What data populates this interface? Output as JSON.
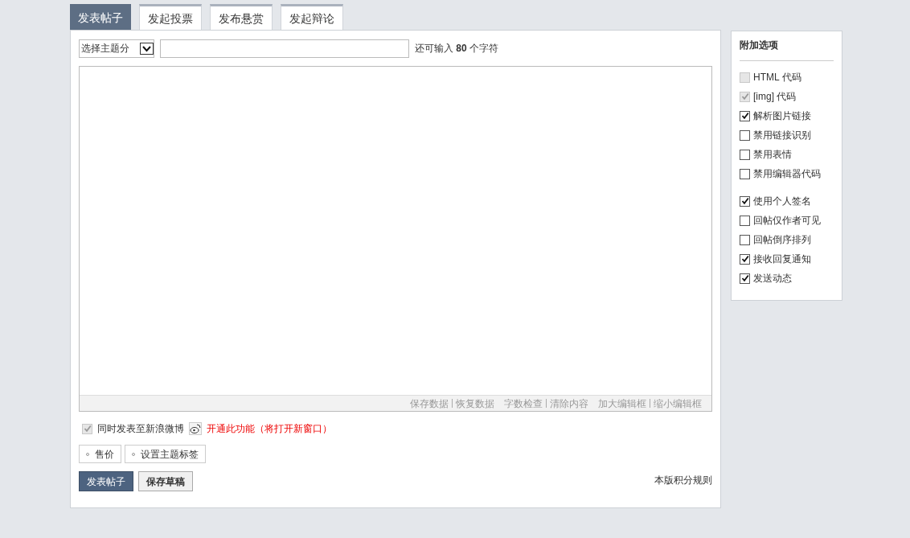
{
  "tabs": [
    {
      "label": "发表帖子",
      "selected": true
    },
    {
      "label": "发起投票",
      "selected": false
    },
    {
      "label": "发布悬赏",
      "selected": false
    },
    {
      "label": "发起辩论",
      "selected": false
    }
  ],
  "title_row": {
    "category_select": "选择主题分",
    "hint": "还可输入 **80** 个字符"
  },
  "editor": {
    "toolbar_groups": [
      [
        "保存数据",
        "恢复数据"
      ],
      [
        "字数检查",
        "清除内容"
      ],
      [
        "加大编辑框",
        "缩小编辑框"
      ]
    ]
  },
  "weibo": {
    "checked": true,
    "label": "同时发表至新浪微博",
    "link": "开通此功能（将打开新窗口）"
  },
  "extras": [
    "售价",
    "设置主题标签"
  ],
  "buttons": [
    {
      "label": "发表帖子",
      "kind": "primary"
    },
    {
      "label": "保存草稿",
      "kind": "secondary"
    }
  ],
  "rules_link": "本版积分规则",
  "options": {
    "title": "附加选项",
    "groups": [
      [
        {
          "label": "HTML 代码",
          "checked": false,
          "disabled": true
        },
        {
          "label": "[img] 代码",
          "checked": true,
          "disabled": true
        },
        {
          "label": "解析图片链接",
          "checked": true,
          "disabled": false
        },
        {
          "label": "禁用链接识别",
          "checked": false,
          "disabled": false
        },
        {
          "label": "禁用表情",
          "checked": false,
          "disabled": false
        },
        {
          "label": "禁用编辑器代码",
          "checked": false,
          "disabled": false
        }
      ],
      [
        {
          "label": "使用个人签名",
          "checked": true,
          "disabled": false
        },
        {
          "label": "回帖仅作者可见",
          "checked": false,
          "disabled": false
        },
        {
          "label": "回帖倒序排列",
          "checked": false,
          "disabled": false
        },
        {
          "label": "接收回复通知",
          "checked": true,
          "disabled": false
        },
        {
          "label": "发送动态",
          "checked": true,
          "disabled": false
        }
      ]
    ]
  }
}
